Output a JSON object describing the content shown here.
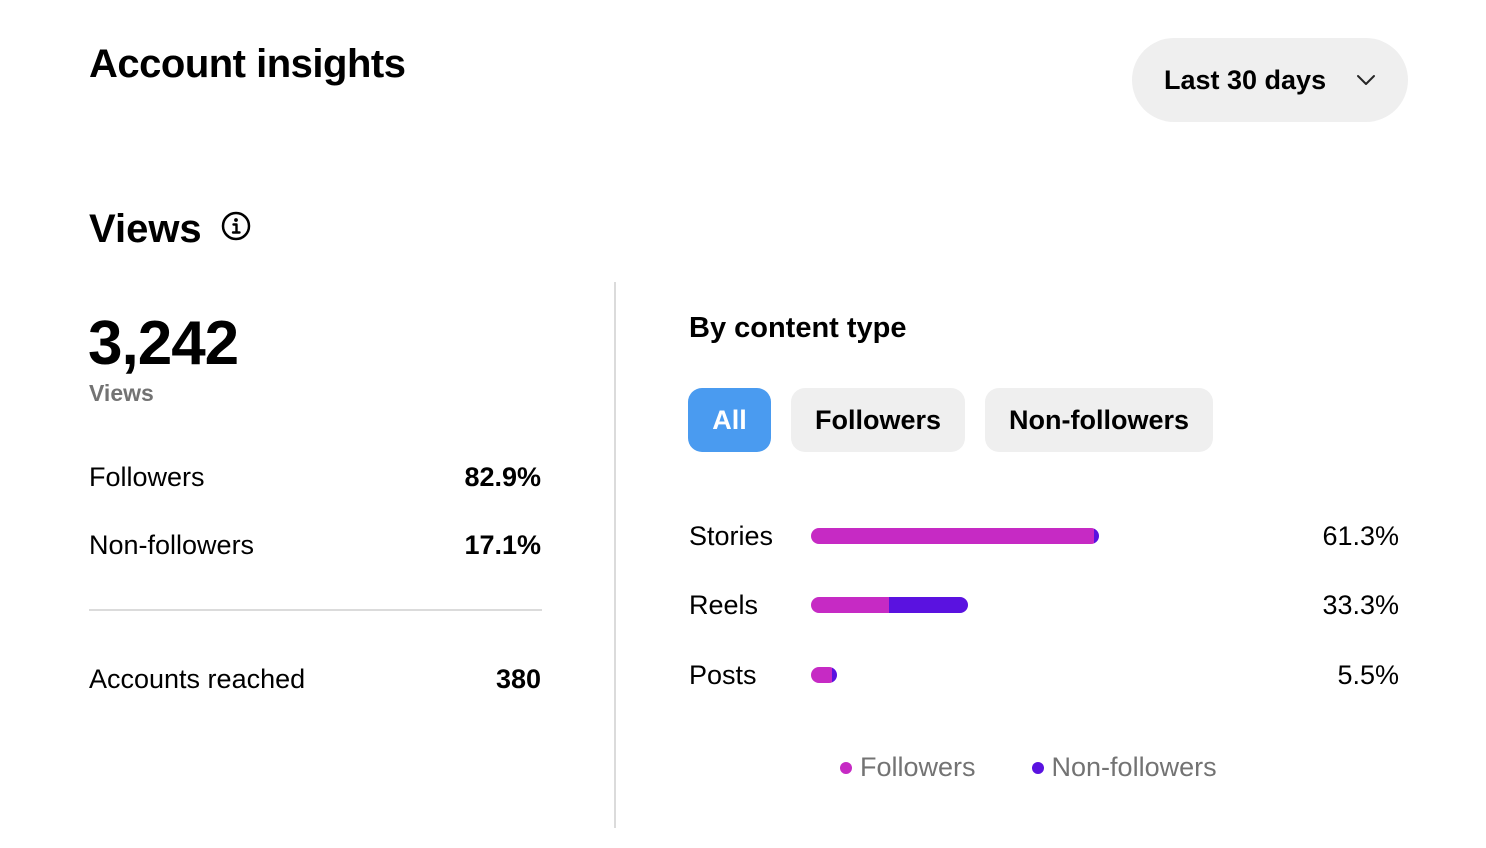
{
  "header": {
    "title": "Account insights",
    "date_range": "Last 30 days"
  },
  "views": {
    "heading": "Views",
    "total": "3,242",
    "total_label": "Views",
    "rows": [
      {
        "label": "Followers",
        "value": "82.9%"
      },
      {
        "label": "Non-followers",
        "value": "17.1%"
      }
    ],
    "reach": {
      "label": "Accounts reached",
      "value": "380"
    }
  },
  "content_type": {
    "heading": "By content type",
    "filters": [
      "All",
      "Followers",
      "Non-followers"
    ],
    "active_filter": "All",
    "legend": [
      "Followers",
      "Non-followers"
    ]
  },
  "colors": {
    "followers": "#c62ac4",
    "non_followers": "#5a12e0",
    "active_chip": "#4a9bf0"
  },
  "icons": {
    "date_range": "chevron-down-icon",
    "views_heading": "info-icon"
  },
  "chart_data": {
    "type": "bar",
    "orientation": "horizontal",
    "stacked": true,
    "categories": [
      "Stories",
      "Reels",
      "Posts"
    ],
    "totals": [
      61.3,
      33.3,
      5.5
    ],
    "total_labels": [
      "61.3%",
      "33.3%",
      "5.5%"
    ],
    "series": [
      {
        "name": "Followers",
        "values": [
          60.3,
          16.6,
          4.5
        ]
      },
      {
        "name": "Non-followers",
        "values": [
          1.0,
          16.7,
          1.0
        ]
      }
    ],
    "xlim": [
      0,
      100
    ]
  }
}
